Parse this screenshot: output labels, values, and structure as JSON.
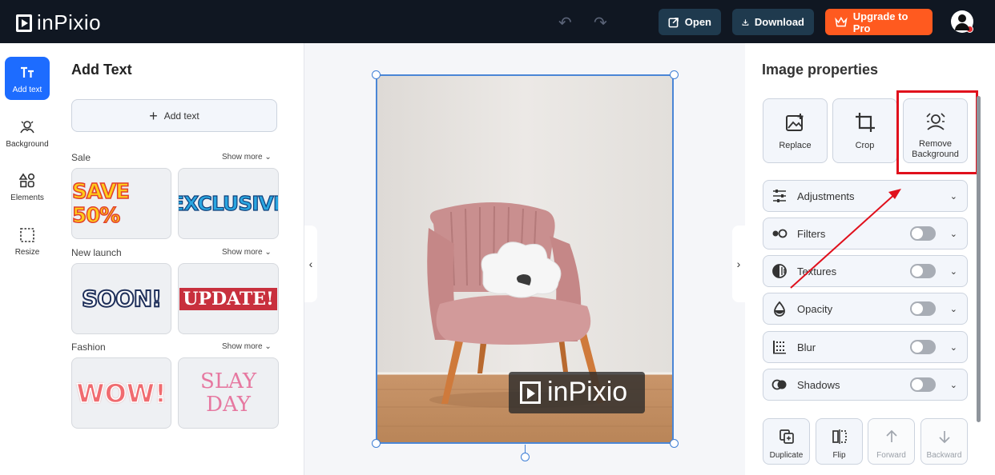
{
  "brand": {
    "name": "inPixio"
  },
  "topbar": {
    "open_label": "Open",
    "download_label": "Download",
    "upgrade_label": "Upgrade to Pro"
  },
  "rail": {
    "items": [
      {
        "label": "Add text"
      },
      {
        "label": "Background"
      },
      {
        "label": "Elements"
      },
      {
        "label": "Resize"
      }
    ]
  },
  "text_panel": {
    "title": "Add Text",
    "add_button": "Add text",
    "sections": [
      {
        "label": "Sale",
        "more": "Show more",
        "stickers": [
          "SAVE 50%",
          "EXCLUSIVE"
        ]
      },
      {
        "label": "New launch",
        "more": "Show more",
        "stickers": [
          "SOON!",
          "UPDATE!"
        ]
      },
      {
        "label": "Fashion",
        "more": "Show more",
        "stickers": [
          "WOW!",
          "SLAY DAY"
        ]
      }
    ]
  },
  "canvas": {
    "watermark": "inPixio"
  },
  "properties": {
    "title": "Image properties",
    "tools": [
      {
        "label": "Replace",
        "icon": "replace-image-icon"
      },
      {
        "label": "Crop",
        "icon": "crop-icon"
      },
      {
        "label": "Remove Background",
        "icon": "remove-background-icon"
      }
    ],
    "rows": [
      {
        "label": "Adjustments",
        "icon": "sliders-icon",
        "toggle": false
      },
      {
        "label": "Filters",
        "icon": "filters-icon",
        "toggle": true,
        "on": false
      },
      {
        "label": "Textures",
        "icon": "textures-icon",
        "toggle": true,
        "on": false
      },
      {
        "label": "Opacity",
        "icon": "opacity-icon",
        "toggle": true,
        "on": false
      },
      {
        "label": "Blur",
        "icon": "blur-icon",
        "toggle": true,
        "on": false
      },
      {
        "label": "Shadows",
        "icon": "shadows-icon",
        "toggle": true,
        "on": false
      }
    ],
    "actions": [
      {
        "label": "Duplicate",
        "enabled": true
      },
      {
        "label": "Flip",
        "enabled": true
      },
      {
        "label": "Forward",
        "enabled": false
      },
      {
        "label": "Backward",
        "enabled": false
      }
    ]
  },
  "colors": {
    "topbar": "#101722",
    "accent_blue": "#1d6cff",
    "upgrade_orange": "#ff5a1f",
    "highlight_red": "#e0101c"
  }
}
